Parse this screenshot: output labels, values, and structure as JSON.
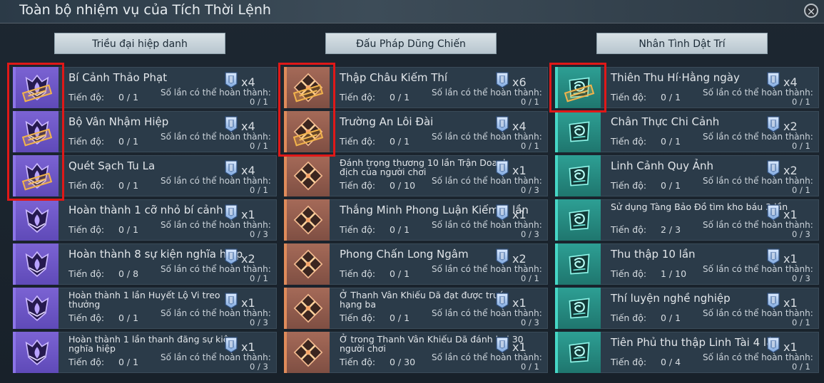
{
  "title": "Toàn bộ nhiệm vụ của Tích Thời Lệnh",
  "close_label": "×",
  "progress_label": "Tiến độ:",
  "completion_label": "Số lần có thể hoàn thành:",
  "colors": {
    "purple": "#7b63d3",
    "orange": "#a56a58",
    "teal": "#2d9f94",
    "highlight": "#e01818"
  },
  "columns": [
    {
      "header": "Triều đại hiệp danh",
      "theme": "purple",
      "tasks": [
        {
          "name": "Bí Cảnh Thảo Phạt",
          "progress": "0 / 1",
          "mult": "x4",
          "completion": "0 / 1",
          "stamped": true
        },
        {
          "name": "Bộ Vân Nhậm Hiệp",
          "progress": "0 / 1",
          "mult": "x4",
          "completion": "0 / 1",
          "stamped": true
        },
        {
          "name": "Quét Sạch Tu La",
          "progress": "0 / 1",
          "mult": "x4",
          "completion": "0 / 1",
          "stamped": true
        },
        {
          "name": "Hoàn thành 1 cỡ nhỏ bí cảnh",
          "progress": "0 / 1",
          "mult": "x1",
          "completion": "0 / 3",
          "stamped": false
        },
        {
          "name": "Hoàn thành 8 sự kiện nghĩa hiệp",
          "progress": "0 / 8",
          "mult": "x2",
          "completion": "0 / 1",
          "stamped": false
        },
        {
          "name": "Hoàn thành 1 lần Huyết Lộ Vi treo thưởng",
          "progress": "0 / 1",
          "mult": "x1",
          "completion": "0 / 3",
          "stamped": false
        },
        {
          "name": "Hoàn thành 1 lần thanh đãng sự kiện nghĩa hiệp",
          "progress": "0 / 1",
          "mult": "x1",
          "completion": "0 / 3",
          "stamped": false
        }
      ]
    },
    {
      "header": "Đấu Pháp Dũng Chiến",
      "theme": "orange",
      "tasks": [
        {
          "name": "Thập Châu Kiếm Thí",
          "progress": "0 / 1",
          "mult": "x6",
          "completion": "0 / 1",
          "stamped": true
        },
        {
          "name": "Trường An Lôi Đài",
          "progress": "0 / 1",
          "mult": "x4",
          "completion": "0 / 1",
          "stamped": true
        },
        {
          "name": "Đánh trọng thương 10 lần Trận Doanh địch của người chơi",
          "progress": "0 / 10",
          "mult": "x1",
          "completion": "0 / 3",
          "stamped": false
        },
        {
          "name": "Thắng Minh Phong Luận Kiếm 1 lần",
          "progress": "0 / 1",
          "mult": "x1",
          "completion": "0 / 3",
          "stamped": false
        },
        {
          "name": "Phong Chấn Long Ngâm",
          "progress": "0 / 1",
          "mult": "x2",
          "completion": "0 / 1",
          "stamped": false
        },
        {
          "name": "Ở Thanh Vân Khiếu Dã đạt được trước hạng ba",
          "progress": "0 / 1",
          "mult": "x1",
          "completion": "0 / 3",
          "stamped": false
        },
        {
          "name": "Ở trong Thanh Vân Khiếu Dã đánh bại 30 người chơi",
          "progress": "0 / 30",
          "mult": "x1",
          "completion": "0 / 1",
          "stamped": false
        }
      ]
    },
    {
      "header": "Nhân Tình Dật Trí",
      "theme": "teal",
      "tasks": [
        {
          "name": "Thiên Thu Hí·Hằng ngày",
          "progress": "0 / 1",
          "mult": "x4",
          "completion": "0 / 1",
          "stamped": true
        },
        {
          "name": "Chân Thực Chi Cảnh",
          "progress": "0 / 1",
          "mult": "x2",
          "completion": "0 / 1",
          "stamped": false
        },
        {
          "name": "Linh Cảnh Quy Ảnh",
          "progress": "0 / 1",
          "mult": "x2",
          "completion": "0 / 1",
          "stamped": false
        },
        {
          "name": "Sử dụng Tàng Bảo Đồ tìm kho báu 3 lần",
          "progress": "2 / 3",
          "mult": "x1",
          "completion": "0 / 3",
          "stamped": false
        },
        {
          "name": "Thu thập 10 lần",
          "progress": "1 / 10",
          "mult": "x1",
          "completion": "0 / 3",
          "stamped": false
        },
        {
          "name": "Thí luyện nghề nghiệp",
          "progress": "0 / 1",
          "mult": "x1",
          "completion": "0 / 1",
          "stamped": false
        },
        {
          "name": "Tiên Phủ thu thập Linh Tài 4 lần",
          "progress": "0 / 4",
          "mult": "x1",
          "completion": "0 / 1",
          "stamped": false
        }
      ]
    }
  ]
}
